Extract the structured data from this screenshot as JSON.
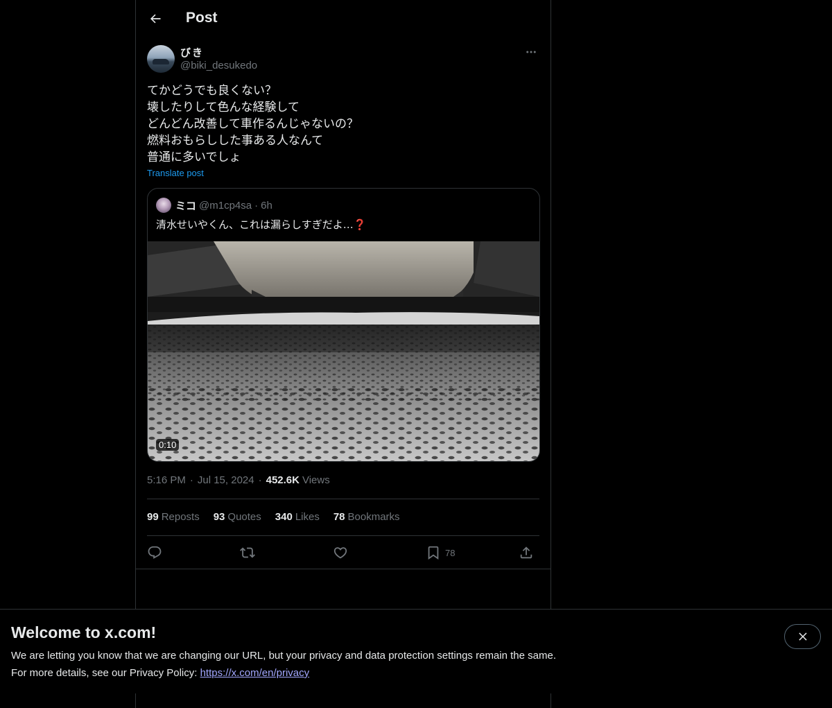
{
  "header": {
    "title": "Post"
  },
  "author": {
    "name": "びき",
    "handle": "@biki_desukedo"
  },
  "tweet": {
    "lines": [
      "てかどうでも良くない？",
      "壊したりして色んな経験して",
      "どんどん改善して車作るんじゃないの？",
      "燃料おもらしした事ある人なんて",
      "普通に多いでしょ"
    ],
    "translate_label": "Translate post"
  },
  "quote": {
    "name": "ミコ",
    "handle": "@m1cp4sa",
    "dot": "·",
    "time": "6h",
    "text": "清水せいやくん、これは漏らしすぎだよ…❓",
    "video_duration": "0:10"
  },
  "meta": {
    "time": "5:16 PM",
    "sep": "·",
    "date": "Jul 15, 2024",
    "views_count": "452.6K",
    "views_label": "Views"
  },
  "stats": [
    {
      "count": "99",
      "label": "Reposts"
    },
    {
      "count": "93",
      "label": "Quotes"
    },
    {
      "count": "340",
      "label": "Likes"
    },
    {
      "count": "78",
      "label": "Bookmarks"
    }
  ],
  "actions": {
    "bookmark_count": "78"
  },
  "banner": {
    "title": "Welcome to x.com!",
    "line1": "We are letting you know that we are changing our URL, but your privacy and data protection settings remain the same.",
    "line2_prefix": "For more details, see our Privacy Policy: ",
    "link": "https://x.com/en/privacy"
  },
  "colors": {
    "background": "#000000",
    "text": "#e7e9ea",
    "muted": "#71767b",
    "accent": "#1d9bf0",
    "border": "#2f3336"
  }
}
